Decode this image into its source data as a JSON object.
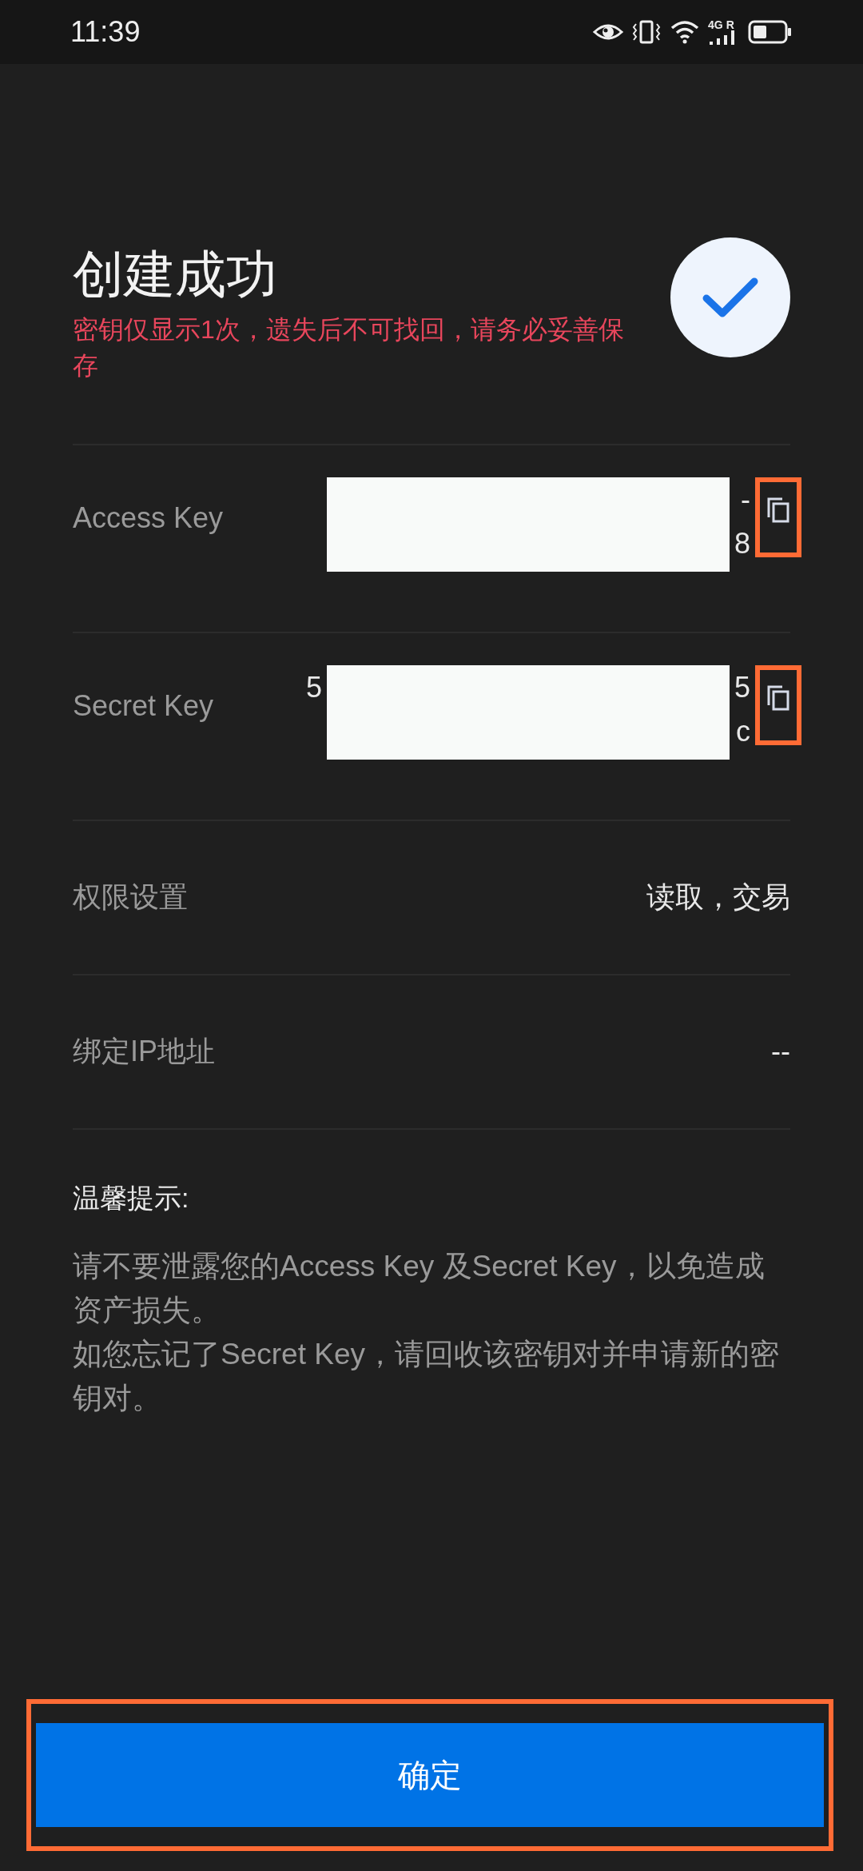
{
  "status_bar": {
    "time": "11:39",
    "network": "4G",
    "network_badge": "R"
  },
  "header": {
    "title": "创建成功",
    "warning": "密钥仅显示1次，遗失后不可找回，请务必妥善保存",
    "success": true
  },
  "keys": [
    {
      "label": "Access Key",
      "redacted": true,
      "copy_highlighted": true,
      "value_lines": [
        {
          "end": "-"
        },
        {
          "end": "8"
        }
      ]
    },
    {
      "label": "Secret Key",
      "redacted": true,
      "copy_highlighted": true,
      "value_lines": [
        {
          "start": "5",
          "end": "5"
        },
        {
          "end": "c"
        }
      ]
    }
  ],
  "details": [
    {
      "label": "权限设置",
      "value": "读取，交易"
    },
    {
      "label": "绑定IP地址",
      "value": "--"
    }
  ],
  "tips": {
    "title": "温馨提示:",
    "paragraphs": [
      "请不要泄露您的Access Key 及Secret Key，以免造成资产损失。",
      "如您忘记了Secret Key，请回收该密钥对并申请新的密钥对。"
    ]
  },
  "confirm_button": {
    "label": "确定",
    "highlighted": true
  }
}
